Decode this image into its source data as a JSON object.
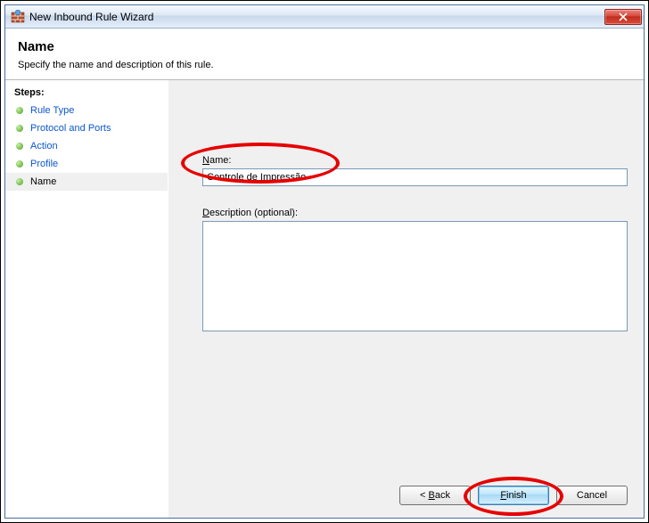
{
  "window": {
    "title": "New Inbound Rule Wizard"
  },
  "header": {
    "title": "Name",
    "subtitle": "Specify the name and description of this rule."
  },
  "sidebar": {
    "heading": "Steps:",
    "items": [
      {
        "label": "Rule Type"
      },
      {
        "label": "Protocol and Ports"
      },
      {
        "label": "Action"
      },
      {
        "label": "Profile"
      },
      {
        "label": "Name"
      }
    ]
  },
  "form": {
    "name_label_prefix": "N",
    "name_label_rest": "ame:",
    "name_value": "Controle de Impressão",
    "desc_label_prefix": "D",
    "desc_label_rest": "escription (optional):",
    "desc_value": ""
  },
  "buttons": {
    "back_prefix": "< ",
    "back_ul": "B",
    "back_rest": "ack",
    "finish_ul": "F",
    "finish_rest": "inish",
    "cancel": "Cancel"
  }
}
